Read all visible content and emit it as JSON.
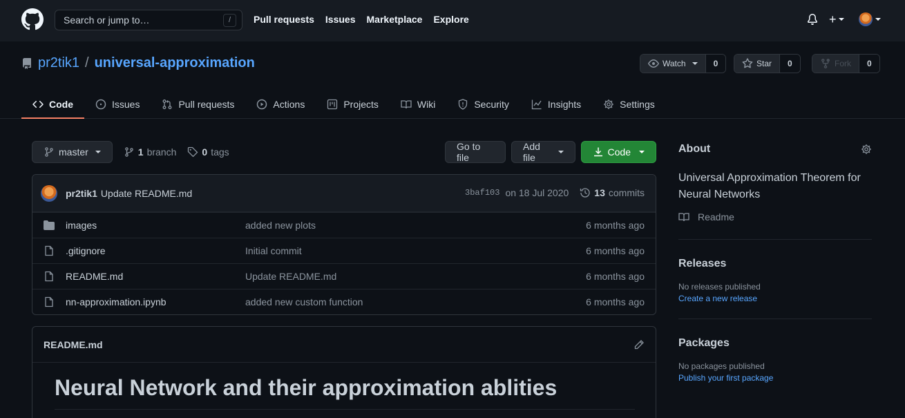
{
  "header": {
    "search_placeholder": "Search or jump to…",
    "search_shortcut": "/",
    "nav": [
      "Pull requests",
      "Issues",
      "Marketplace",
      "Explore"
    ],
    "plus_label": "+"
  },
  "repo": {
    "owner": "pr2tik1",
    "separator": "/",
    "name": "universal-approximation",
    "watch": {
      "label": "Watch",
      "count": "0"
    },
    "star": {
      "label": "Star",
      "count": "0"
    },
    "fork": {
      "label": "Fork",
      "count": "0"
    }
  },
  "tabs": [
    {
      "label": "Code",
      "icon": "code-icon"
    },
    {
      "label": "Issues",
      "icon": "issue-icon"
    },
    {
      "label": "Pull requests",
      "icon": "pull-request-icon"
    },
    {
      "label": "Actions",
      "icon": "play-icon"
    },
    {
      "label": "Projects",
      "icon": "project-icon"
    },
    {
      "label": "Wiki",
      "icon": "book-icon"
    },
    {
      "label": "Security",
      "icon": "shield-icon"
    },
    {
      "label": "Insights",
      "icon": "graph-icon"
    },
    {
      "label": "Settings",
      "icon": "gear-icon"
    }
  ],
  "branchbar": {
    "branch": "master",
    "branch_count": "1",
    "branch_word": "branch",
    "tag_count": "0",
    "tag_word": "tags",
    "go_to_file": "Go to file",
    "add_file": "Add file",
    "code": "Code"
  },
  "commit": {
    "author": "pr2tik1",
    "message": "Update README.md",
    "sha": "3baf103",
    "date": "on 18 Jul 2020",
    "count": "13",
    "count_word": "commits"
  },
  "files": [
    {
      "name": "images",
      "message": "added new plots",
      "age": "6 months ago",
      "type": "folder"
    },
    {
      "name": ".gitignore",
      "message": "Initial commit",
      "age": "6 months ago",
      "type": "file"
    },
    {
      "name": "README.md",
      "message": "Update README.md",
      "age": "6 months ago",
      "type": "file"
    },
    {
      "name": "nn-approximation.ipynb",
      "message": "added new custom function",
      "age": "6 months ago",
      "type": "file"
    }
  ],
  "readme": {
    "filename": "README.md",
    "heading": "Neural Network and their approximation ablities"
  },
  "sidebar": {
    "about_title": "About",
    "about_desc": "Universal Approximation Theorem for Neural Networks",
    "readme_label": "Readme",
    "releases_title": "Releases",
    "releases_none": "No releases published",
    "releases_link": "Create a new release",
    "packages_title": "Packages",
    "packages_none": "No packages published",
    "packages_link": "Publish your first package"
  },
  "colors": {
    "accent_link": "#58a6ff",
    "active_tab": "#f78166",
    "code_button": "#238636",
    "background": "#0d1117",
    "header": "#161b22"
  }
}
